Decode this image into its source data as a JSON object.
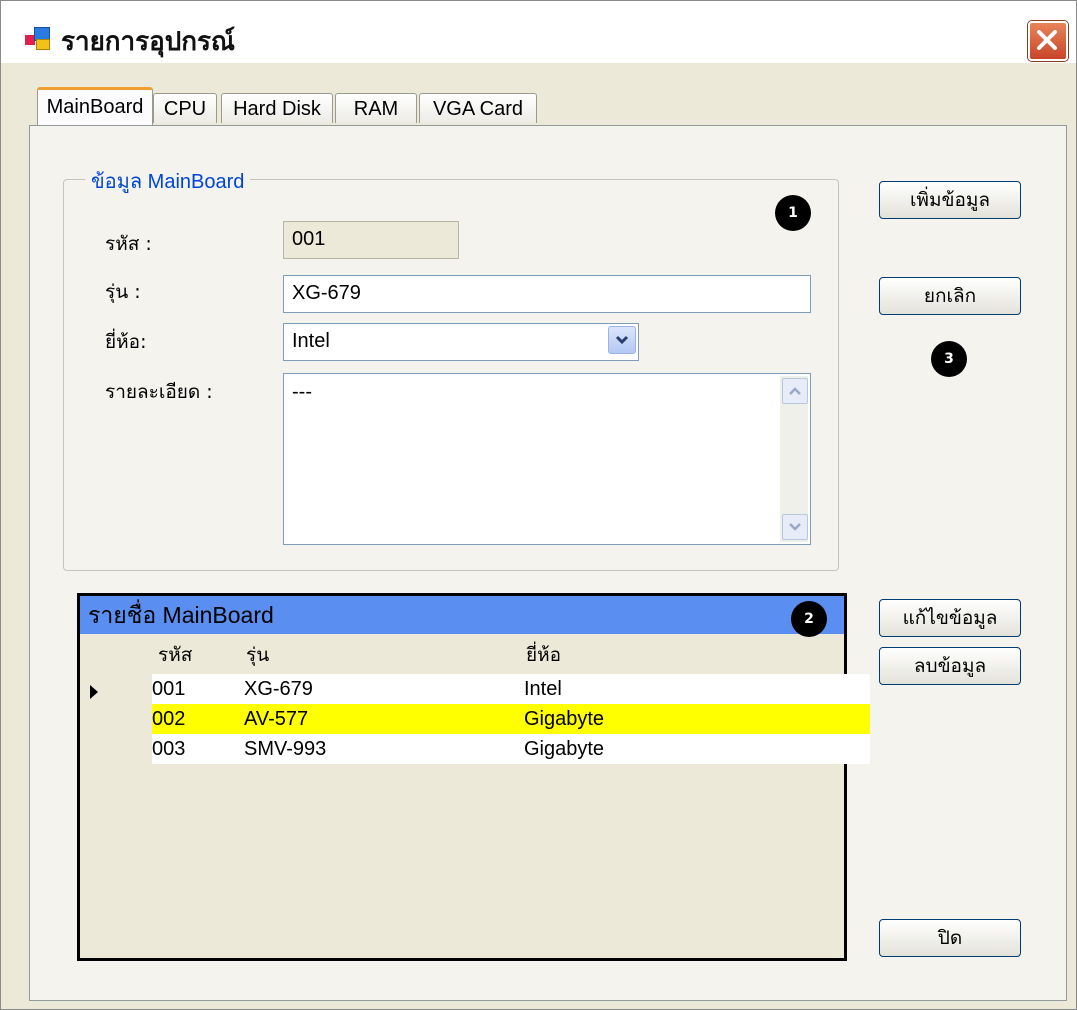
{
  "window": {
    "title": "รายการอุปกรณ์"
  },
  "tabs": [
    {
      "label": "MainBoard",
      "active": true
    },
    {
      "label": "CPU",
      "active": false
    },
    {
      "label": "Hard Disk",
      "active": false
    },
    {
      "label": "RAM",
      "active": false
    },
    {
      "label": "VGA Card",
      "active": false
    }
  ],
  "form": {
    "group_title": "ข้อมูล MainBoard",
    "code_label": "รหัส :",
    "code_value": "001",
    "model_label": "รุ่น :",
    "model_value": "XG-679",
    "brand_label": "ยี่ห้อ:",
    "brand_value": "Intel",
    "detail_label": "รายละเอียด :",
    "detail_value": "---"
  },
  "buttons": {
    "add": "เพิ่มข้อมูล",
    "cancel": "ยกเลิก",
    "edit": "แก้ไขข้อมูล",
    "delete": "ลบข้อมูล",
    "close": "ปิด"
  },
  "badges": [
    "1",
    "2",
    "3"
  ],
  "grid": {
    "caption": "รายชื่อ MainBoard",
    "columns": [
      "รหัส",
      "รุ่น",
      "ยี่ห้อ"
    ],
    "rows": [
      {
        "code": "001",
        "model": "XG-679",
        "brand": "Intel",
        "current": true,
        "selected": false
      },
      {
        "code": "002",
        "model": "AV-577",
        "brand": "Gigabyte",
        "current": false,
        "selected": true
      },
      {
        "code": "003",
        "model": "SMV-993",
        "brand": "Gigabyte",
        "current": false,
        "selected": false
      }
    ]
  },
  "colors": {
    "grid_caption": "#5a8ef0",
    "selected_row": "#ffff00",
    "group_title": "#0046d5"
  }
}
